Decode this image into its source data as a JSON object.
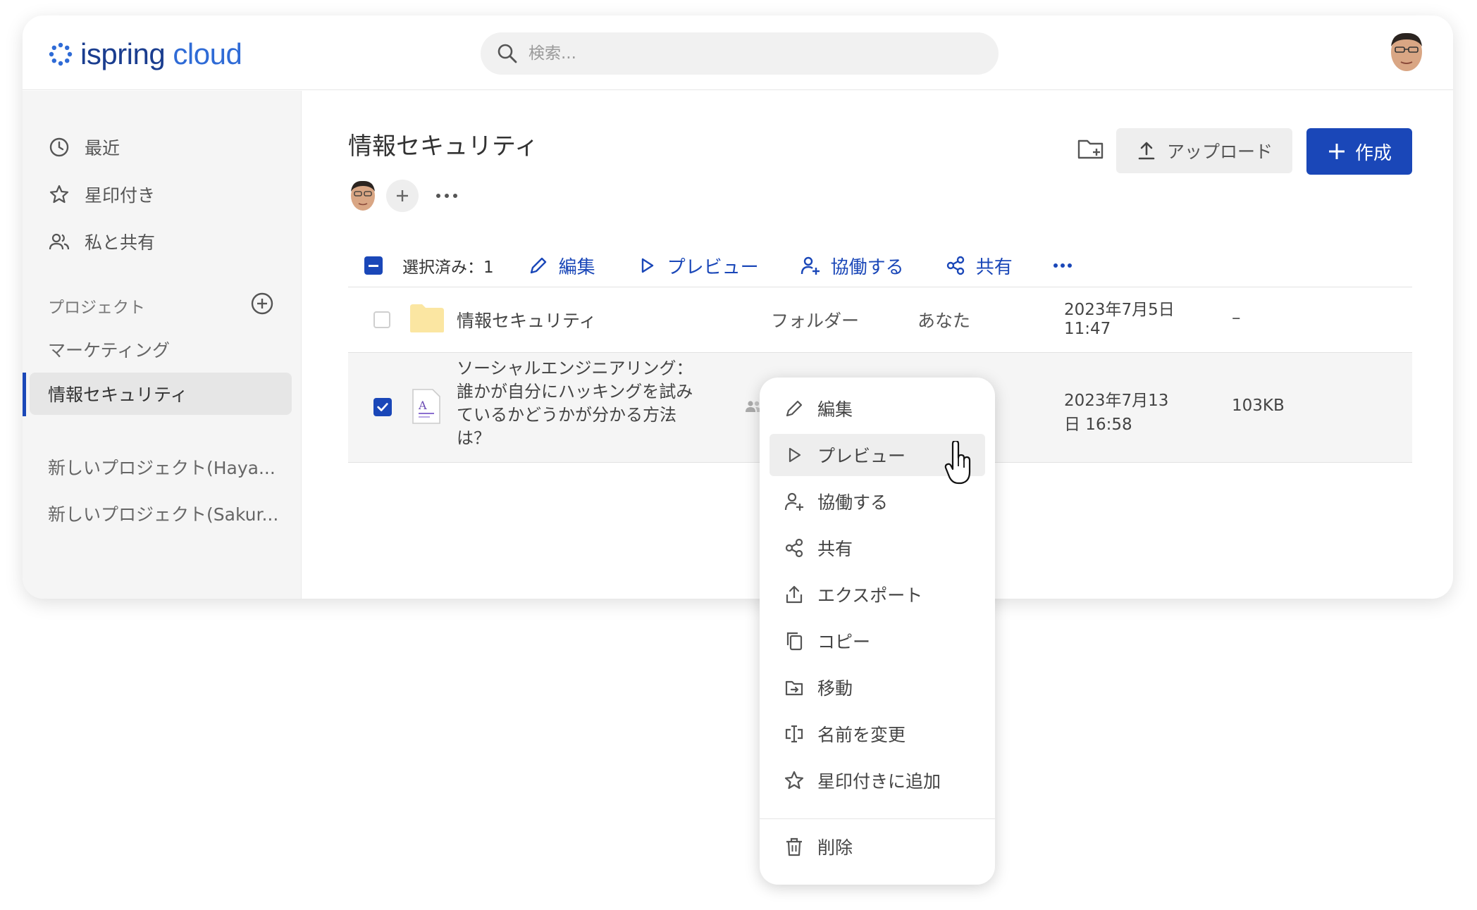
{
  "app": {
    "logo_part1": "ispring",
    "logo_part2": "cloud",
    "search_placeholder": "検索..."
  },
  "sidebar": {
    "nav": [
      {
        "label": "最近",
        "icon": "clock-icon"
      },
      {
        "label": "星印付き",
        "icon": "star-icon"
      },
      {
        "label": "私と共有",
        "icon": "people-icon"
      }
    ],
    "projects_label": "プロジェクト",
    "projects": [
      {
        "label": "マーケティング",
        "active": false
      },
      {
        "label": "情報セキュリティ",
        "active": true
      },
      {
        "label": "新しいプロジェクト(Haya...",
        "active": false
      },
      {
        "label": "新しいプロジェクト(Sakur...",
        "active": false
      }
    ]
  },
  "main": {
    "title": "情報セキュリティ",
    "upload_label": "アップロード",
    "create_label": "作成",
    "actionbar": {
      "selected_label": "選択済み：1",
      "edit": "編集",
      "preview": "プレビュー",
      "collaborate": "協働する",
      "share": "共有"
    },
    "rows": [
      {
        "name": "情報セキュリティ",
        "type": "フォルダー",
        "owner": "あなた",
        "date_line1": "2023年7月5日",
        "date_line2": "11:47",
        "size": "–",
        "checked": false
      },
      {
        "name_lines": [
          "ソーシャルエンジニアリング：",
          "誰かが自分にハッキングを試み",
          "ているかどうかが分かる方法",
          "は？"
        ],
        "date_line1": "2023年7月13",
        "date_line2": "日 16:58",
        "size": "103KB",
        "checked": true
      }
    ]
  },
  "context_menu": {
    "items": [
      {
        "label": "編集",
        "icon": "pencil-icon"
      },
      {
        "label": "プレビュー",
        "icon": "play-icon"
      },
      {
        "label": "協働する",
        "icon": "person-add-icon"
      },
      {
        "label": "共有",
        "icon": "share-icon"
      },
      {
        "label": "エクスポート",
        "icon": "export-icon"
      },
      {
        "label": "コピー",
        "icon": "copy-icon"
      },
      {
        "label": "移動",
        "icon": "move-icon"
      },
      {
        "label": "名前を変更",
        "icon": "rename-icon"
      },
      {
        "label": "星印付きに追加",
        "icon": "star-icon"
      }
    ],
    "delete_label": "削除"
  },
  "colors": {
    "accent": "#1a47b8",
    "sidebar_bg": "#f5f5f5",
    "folder": "#fbe6a2"
  }
}
